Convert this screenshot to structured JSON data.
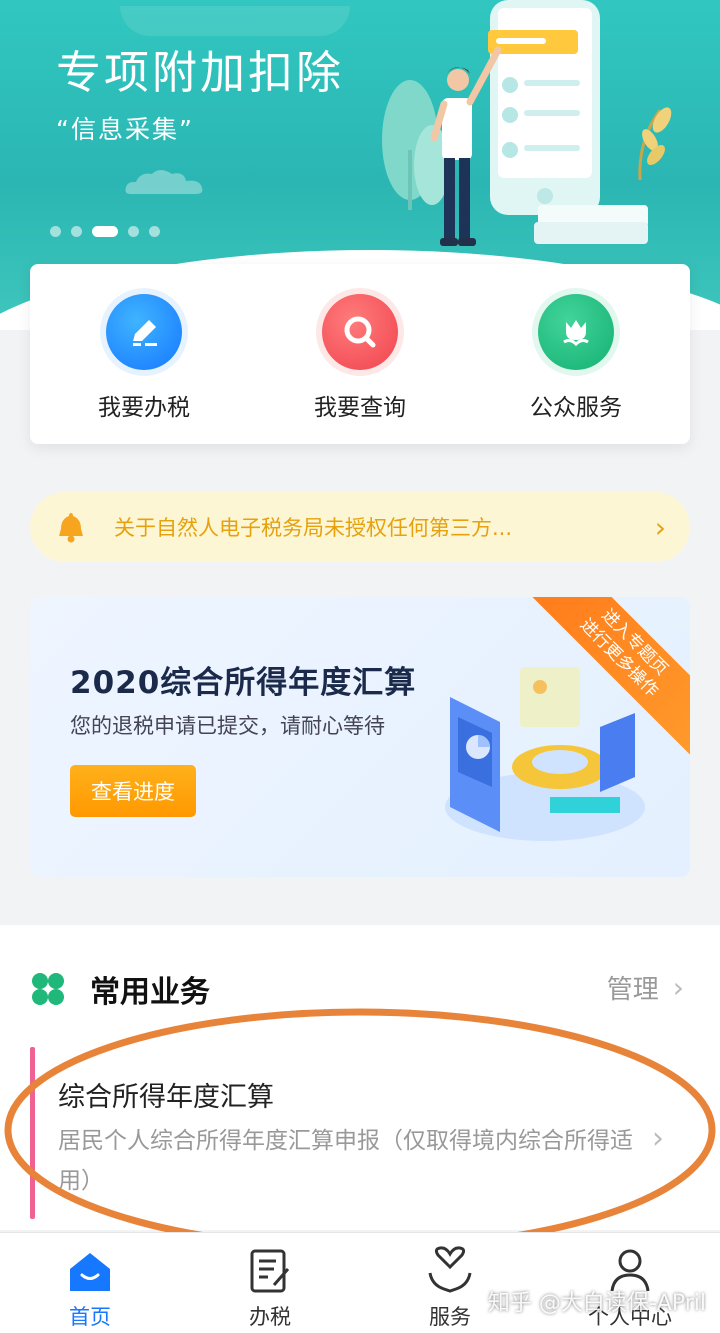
{
  "banner": {
    "title": "专项附加扣除",
    "subtitle": "“信息采集”",
    "slides_total": 5,
    "slide_active": 3
  },
  "quick_actions": [
    {
      "label": "我要办税",
      "icon": "pencil-icon",
      "color": "#1677ff"
    },
    {
      "label": "我要查询",
      "icon": "search-icon",
      "color": "#f0434d"
    },
    {
      "label": "公众服务",
      "icon": "tulip-icon",
      "color": "#14b072"
    }
  ],
  "notice": {
    "text": "关于自然人电子税务局未授权任何第三方...",
    "arrow": "›"
  },
  "promo": {
    "title": "2020综合所得年度汇算",
    "subtitle": "您的退税申请已提交，请耐心等待",
    "button": "查看进度",
    "ribbon_line1": "进入专题页",
    "ribbon_line2": "进行更多操作"
  },
  "section": {
    "title": "常用业务",
    "manage": "管理",
    "items": [
      {
        "title": "综合所得年度汇算",
        "desc": "居民个人综合所得年度汇算申报（仅取得境内综合所得适用）"
      }
    ]
  },
  "tabbar": [
    {
      "label": "首页",
      "icon": "home-icon",
      "active": true
    },
    {
      "label": "办税",
      "icon": "document-edit-icon",
      "active": false
    },
    {
      "label": "服务",
      "icon": "heart-hands-icon",
      "active": false
    },
    {
      "label": "个人中心",
      "icon": "user-icon",
      "active": false
    }
  ],
  "watermark": "知乎 @大白读保-APril",
  "colors": {
    "banner": "#2bb6b3",
    "primary": "#1677ff",
    "notice_bg": "#fdf6d5",
    "notice_text": "#e6a10d",
    "accent_orange": "#ff9800",
    "annotation_circle": "#e8843a"
  }
}
